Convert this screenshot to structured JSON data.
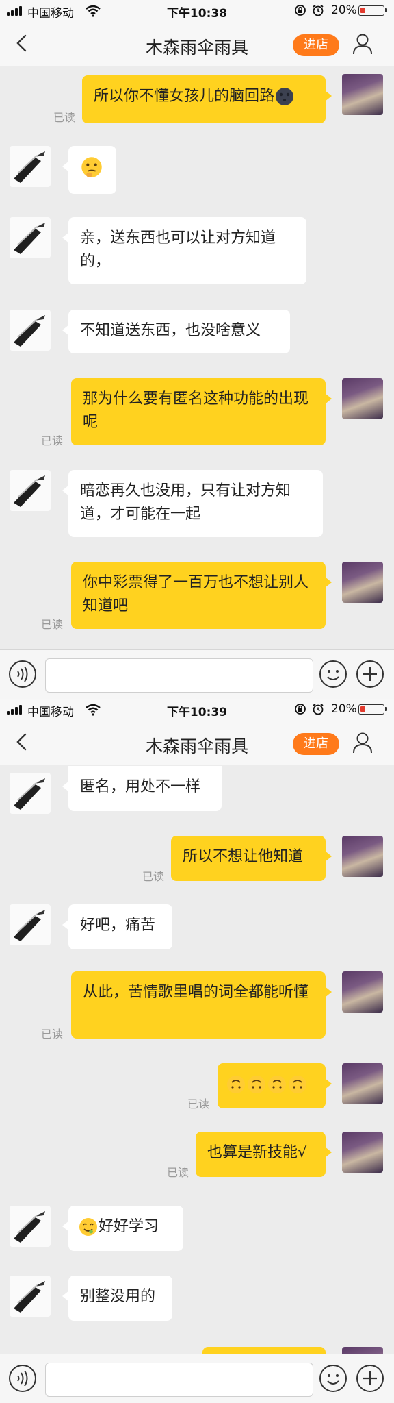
{
  "screen1": {
    "status": {
      "carrier": "中国移动",
      "time": "下午10:38",
      "battery_pct": "20%"
    },
    "nav": {
      "title": "木森雨伞雨具",
      "store_button": "进店"
    },
    "messages": [
      {
        "text": "所以你不懂女孩儿的脑回路",
        "read": "已读"
      },
      {
        "text": ""
      },
      {
        "text": "亲，送东西也可以让对方知道的，"
      },
      {
        "text": "不知道送东西，也没啥意义"
      },
      {
        "text": "那为什么要有匿名这种功能的出现呢",
        "read": "已读"
      },
      {
        "text": "暗恋再久也没用，只有让对方知道，才可能在一起"
      },
      {
        "text": "你中彩票得了一百万也不想让别人知道吧",
        "read": "已读"
      }
    ]
  },
  "screen2": {
    "status": {
      "carrier": "中国移动",
      "time": "下午10:39",
      "battery_pct": "20%"
    },
    "nav": {
      "title": "木森雨伞雨具",
      "store_button": "进店"
    },
    "messages": [
      {
        "text": "匿名，用处不一样"
      },
      {
        "text": "所以不想让他知道",
        "read": "已读"
      },
      {
        "text": "好吧，痛苦"
      },
      {
        "text": "从此，苦情歌里唱的词全都能听懂",
        "read": "已读"
      },
      {
        "text": "",
        "read": "已读"
      },
      {
        "text": "也算是新技能√",
        "read": "已读"
      },
      {
        "text": "好好学习"
      },
      {
        "text": "别整没用的"
      }
    ]
  },
  "icons": {
    "moon": "new-moon-face-icon",
    "thinking": "thinking-face-icon",
    "upside_down": "upside-down-face-icon",
    "yum": "face-savoring-food-icon"
  },
  "colors": {
    "outgoing_bubble": "#ffd21f",
    "incoming_bubble": "#ffffff",
    "store_button": "#ff7a1a",
    "background": "#ececec"
  }
}
